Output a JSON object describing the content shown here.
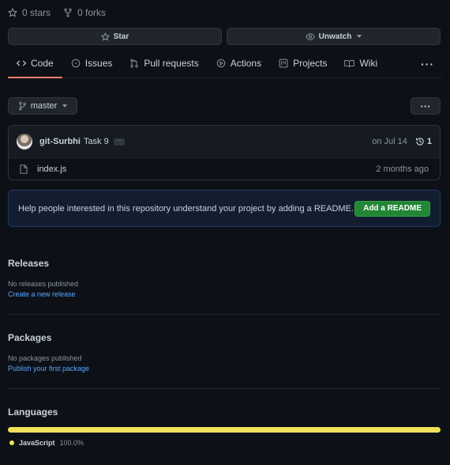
{
  "repo": {
    "stars": "0 stars",
    "forks": "0 forks"
  },
  "actions": {
    "star_label": "Star",
    "unwatch_label": "Unwatch"
  },
  "tabs": [
    {
      "label": "Code",
      "icon": "code-icon",
      "active": true
    },
    {
      "label": "Issues",
      "icon": "issue-icon"
    },
    {
      "label": "Pull requests",
      "icon": "pull-request-icon"
    },
    {
      "label": "Actions",
      "icon": "play-icon"
    },
    {
      "label": "Projects",
      "icon": "project-icon"
    },
    {
      "label": "Wiki",
      "icon": "book-icon"
    }
  ],
  "branch": {
    "name": "master",
    "more_label": "···"
  },
  "commit": {
    "author": "git-Surbhi",
    "message": "Task 9",
    "ellipsis": "···",
    "date": "on Jul 14",
    "history_count": "1"
  },
  "files": [
    {
      "name": "index.js",
      "age": "2 months ago"
    }
  ],
  "readme": {
    "text": "Help people interested in this repository understand your project by adding a README.",
    "button_label": "Add a README"
  },
  "releases": {
    "title": "Releases",
    "empty": "No releases published",
    "link": "Create a new release"
  },
  "packages": {
    "title": "Packages",
    "empty": "No packages published",
    "link": "Publish your first package"
  },
  "languages": {
    "title": "Languages",
    "items": [
      {
        "name": "JavaScript",
        "percent": "100.0%",
        "share": 1.0,
        "color": "#f1e05a"
      }
    ]
  },
  "colors": {
    "background": "#0d1117",
    "accent_tab": "#f78166",
    "link": "#58a6ff",
    "primary_button": "#238636"
  }
}
